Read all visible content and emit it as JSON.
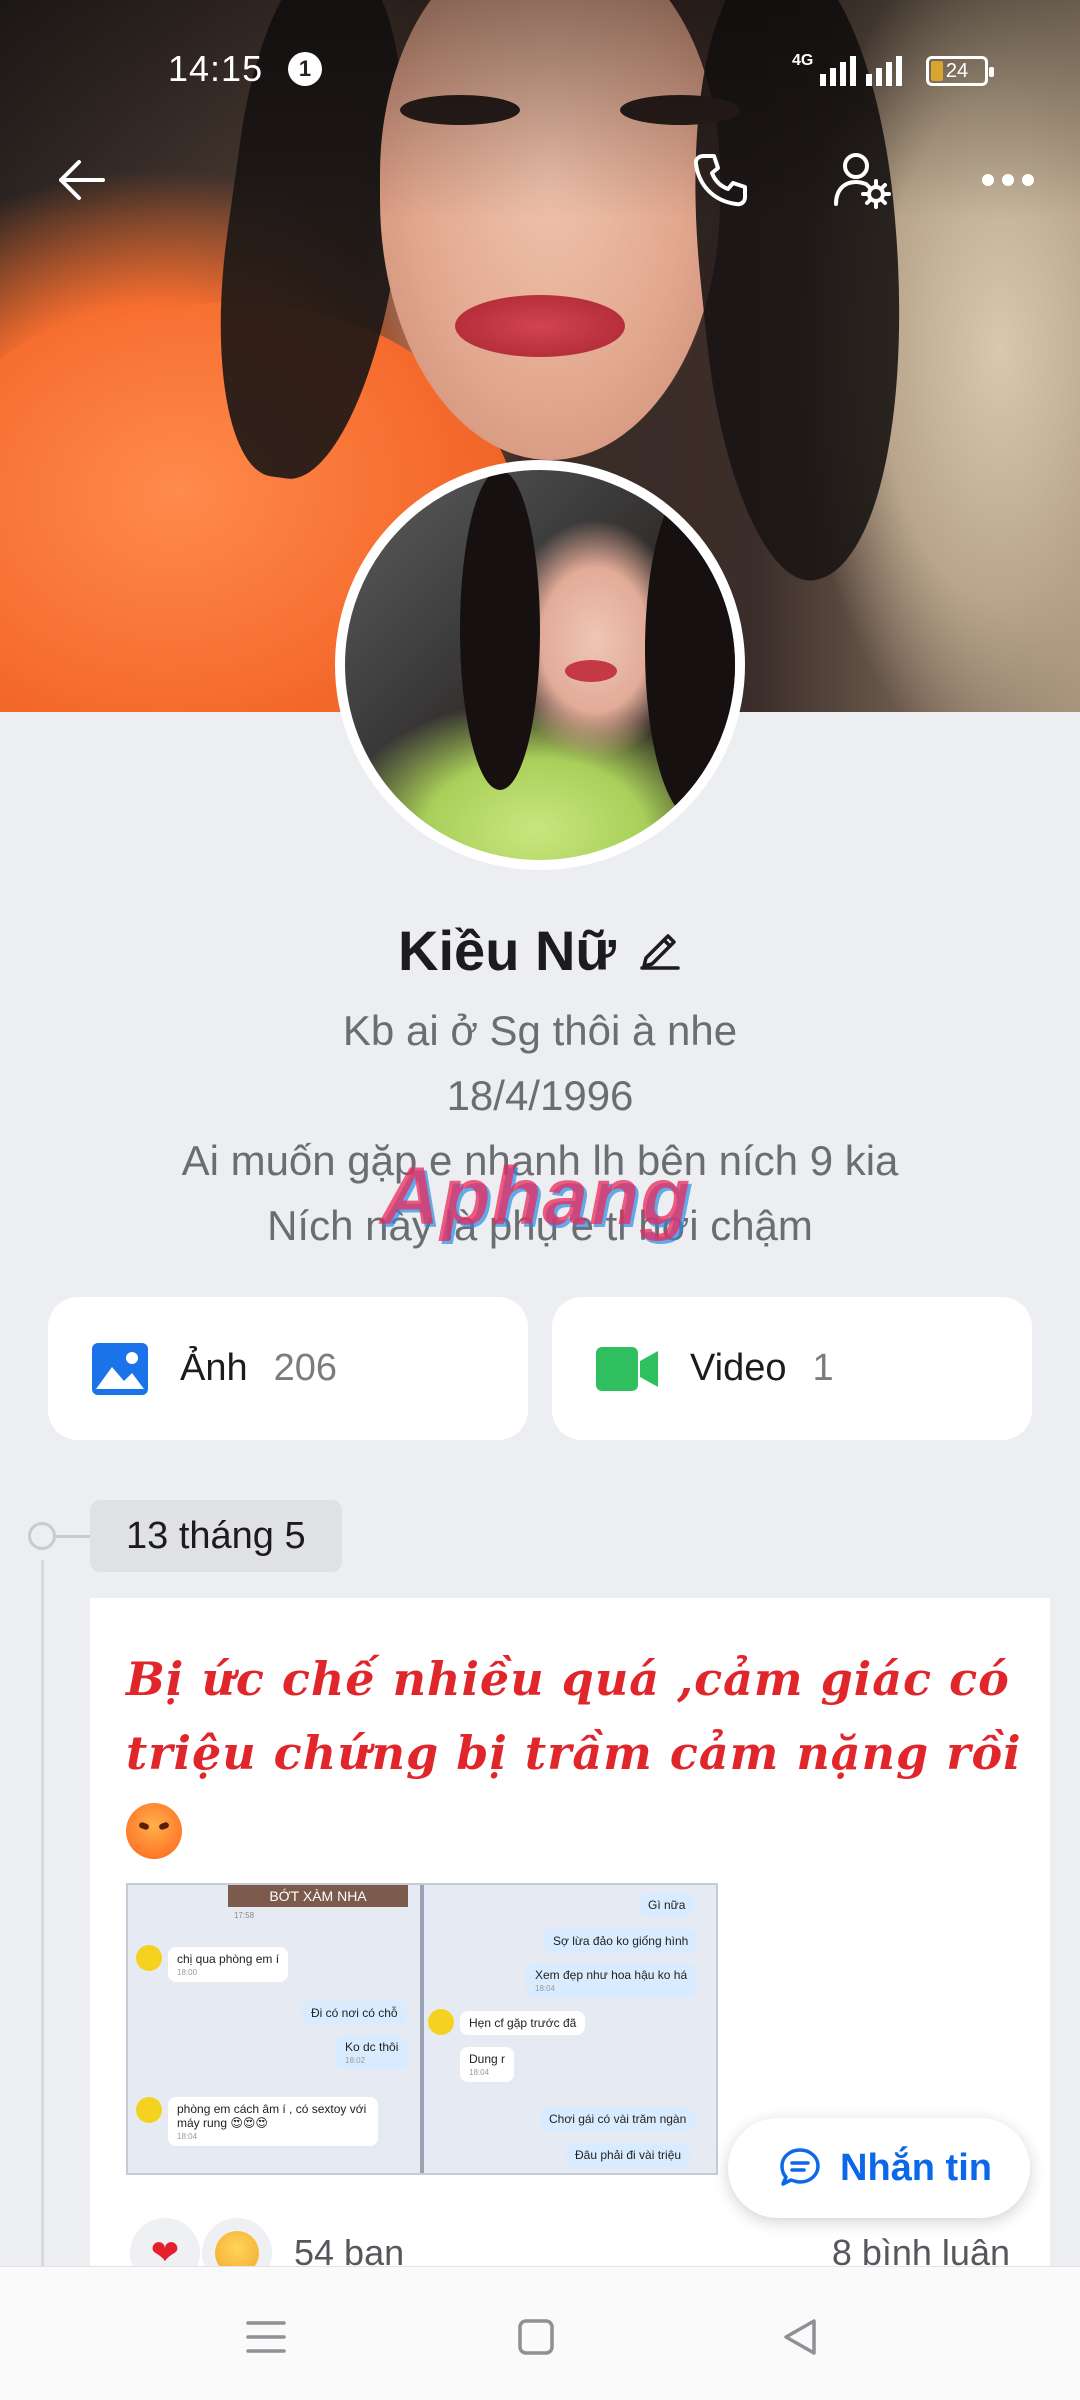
{
  "status_bar": {
    "time": "14:15",
    "notification_count": "1",
    "network": "4G",
    "battery": "24",
    "battery_level_percent": 24
  },
  "header_actions": {
    "back_icon": "arrow-left-icon",
    "call_icon": "phone-icon",
    "settings_icon": "user-settings-icon",
    "more_icon": "more-horizontal-icon"
  },
  "profile": {
    "name": "Kiều Nữ",
    "bio_lines": [
      "Kb ai ở Sg thôi à nhe",
      "18/4/1996",
      "Ai muốn gặp e nhanh lh bên ních 9 kia",
      "Ních này là phụ e tl hơi chậm"
    ]
  },
  "watermark": "Aphang",
  "media": {
    "photos_label": "Ảnh",
    "photos_count": "206",
    "videos_label": "Video",
    "videos_count": "1"
  },
  "timeline": {
    "date": "13 tháng 5"
  },
  "post": {
    "text": "Bị ức chế nhiều quá ,cảm giác có triệu chứng bị trầm cảm nặng rồi",
    "emoji": "angry-face",
    "image": {
      "left_header": "BỚT XÀM NHA",
      "left_messages": [
        {
          "text": "chị qua phòng em í",
          "time": "18:00",
          "from": "them"
        },
        {
          "text": "Đi có nơi có chỗ",
          "time": "",
          "from": "me"
        },
        {
          "text": "Ko dc thôi",
          "time": "18:02",
          "from": "me"
        },
        {
          "text": "phòng em cách âm í , có sextoy với máy rung 😍😍😍",
          "time": "18:04",
          "from": "them"
        }
      ],
      "left_top_time": "17:58",
      "right_messages": [
        {
          "text": "Gì nữa",
          "time": "",
          "from": "me"
        },
        {
          "text": "Sợ lừa đảo ko giống hình",
          "time": "",
          "from": "me"
        },
        {
          "text": "Xem đẹp như hoa hậu ko há",
          "time": "18:04",
          "from": "me"
        },
        {
          "text": "Hẹn cf gặp trước đã",
          "time": "",
          "from": "them"
        },
        {
          "text": "Dung r",
          "time": "18:04",
          "from": "them"
        },
        {
          "text": "Chơi gái có vài trăm ngàn",
          "time": "",
          "from": "me"
        },
        {
          "text": "Đâu phải đi vài triệu",
          "time": "",
          "from": "me"
        }
      ]
    },
    "reactions_label": "54 bạn",
    "comments_label": "8 bình luận"
  },
  "message_button": {
    "label": "Nhắn tin",
    "icon": "chat-bubble-icon"
  },
  "navbar": {
    "menu_icon": "menu-icon",
    "home_icon": "square-home-icon",
    "back_icon": "triangle-back-icon"
  },
  "colors": {
    "accent_blue": "#0b68e8",
    "post_text_red": "#e0262b",
    "background": "#eceef2",
    "video_green": "#2fbf5f",
    "photo_blue": "#1a73e8"
  }
}
